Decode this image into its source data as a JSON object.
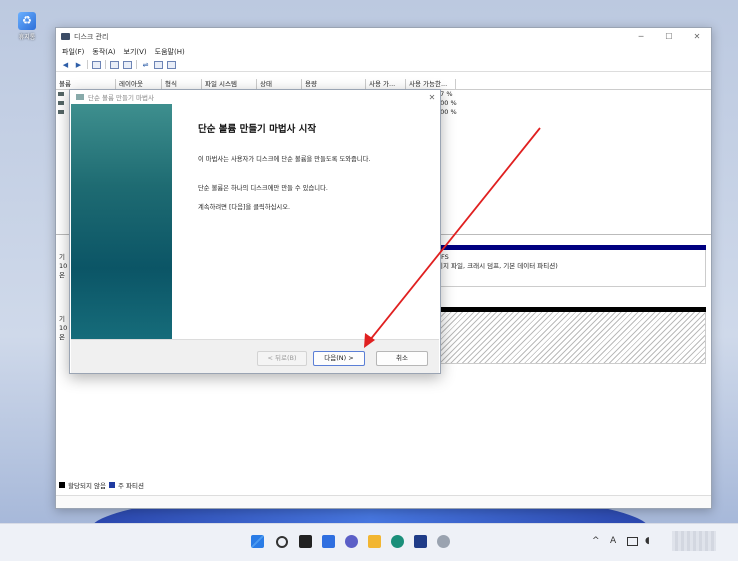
{
  "desktop": {
    "recycle_label": "휴지통"
  },
  "window": {
    "title": "디스크 관리",
    "menus": [
      "파일(F)",
      "동작(A)",
      "보기(V)",
      "도움말(H)"
    ],
    "columns": [
      "볼륨",
      "레이아웃",
      "형식",
      "파일 시스템",
      "상태",
      "용량",
      "사용 가...",
      "사용 가능한..."
    ],
    "volume_pcts": [
      "97 %",
      "100 %",
      "100 %"
    ],
    "disk0": {
      "label_lines": [
        "기",
        "10",
        "온"
      ],
      "part_text_1": "TFS",
      "part_text_2": "이지 파일, 크래시 덤프, 기본 데이터 파티션)"
    },
    "disk1": {
      "label_lines": [
        "기",
        "10",
        "온"
      ]
    },
    "legend": {
      "unallocated": "할당되지 않음",
      "primary": "주 파티션"
    },
    "colors": {
      "unallocated": "#000000",
      "primary": "#1f3aa0",
      "disk0_bar": "#000080"
    }
  },
  "wizard": {
    "title": "단순 볼륨 만들기 마법사",
    "heading": "단순 볼륨 만들기 마법사 시작",
    "para1": "이 마법사는 사용자가 디스크에 단순 볼륨을 만들도록 도와줍니다.",
    "para2": "단순 볼륨은 하나의 디스크에만 만들 수 있습니다.",
    "para3": "계속하려면 [다음]을 클릭하십시오.",
    "back_label": "< 뒤로(B)",
    "next_label": "다음(N) >",
    "cancel_label": "취소"
  },
  "annotation": {
    "color": "#e02020"
  },
  "taskbar": {
    "icons": [
      "start-icon",
      "search-icon",
      "task-view-icon",
      "widgets-icon",
      "chat-icon",
      "file-explorer-icon",
      "edge-icon",
      "store-icon",
      "settings-icon"
    ],
    "tray": [
      "^",
      "A"
    ]
  }
}
